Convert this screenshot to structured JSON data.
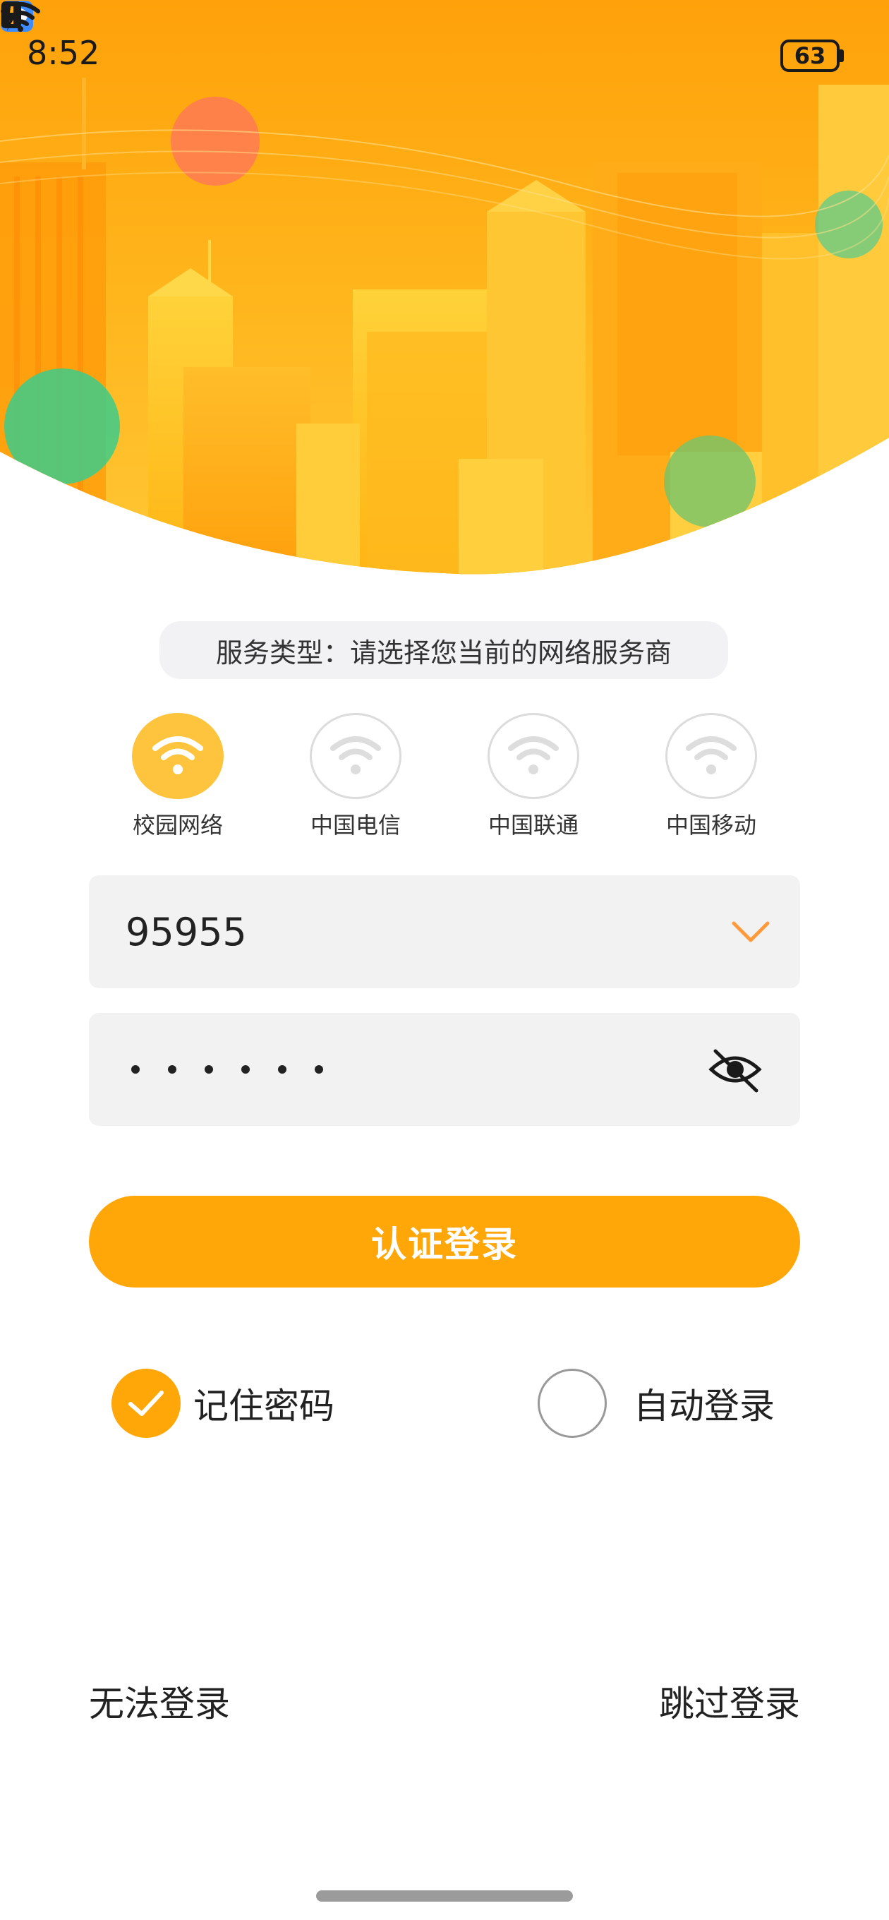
{
  "status_bar": {
    "time": "8:52",
    "battery": "63",
    "icons": [
      "message-icon",
      "wifi-icon",
      "alert-icon",
      "battery-icon",
      "charging-icon"
    ]
  },
  "service_type": {
    "text": "服务类型：请选择您当前的网络服务商"
  },
  "providers": [
    {
      "label": "校园网络",
      "selected": true
    },
    {
      "label": "中国电信",
      "selected": false
    },
    {
      "label": "中国联通",
      "selected": false
    },
    {
      "label": "中国移动",
      "selected": false
    }
  ],
  "account": {
    "value": "95955"
  },
  "password": {
    "masked_length": 6
  },
  "login_button": {
    "label": "认证登录"
  },
  "options": {
    "remember_label": "记住密码",
    "remember_checked": true,
    "auto_login_label": "自动登录",
    "auto_login_checked": false
  },
  "links": {
    "cannot_login": "无法登录",
    "skip_login": "跳过登录"
  },
  "colors": {
    "accent": "#ffa609",
    "selected_provider": "#ffc43d",
    "hero_orange": "#ffad12",
    "field_bg": "#f2f2f2"
  }
}
